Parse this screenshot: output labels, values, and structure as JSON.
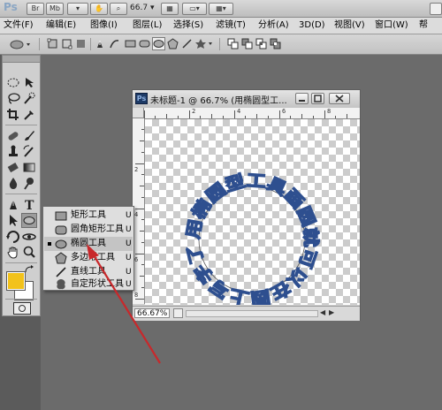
{
  "app": {
    "logo": "Ps",
    "top_buttons": [
      "Br",
      "Mb"
    ],
    "zoom_value": "66.7"
  },
  "menu": {
    "items": [
      "文件(F)",
      "编辑(E)",
      "图像(I)",
      "图层(L)",
      "选择(S)",
      "滤镜(T)",
      "分析(A)",
      "3D(D)",
      "视图(V)",
      "窗口(W)",
      "帮"
    ]
  },
  "options_bar": {
    "tool_icon": "ellipse-shape-icon",
    "shape_modes": [
      "shape-layers-icon",
      "paths-icon",
      "fill-pixels-icon"
    ],
    "shape_tools": [
      "pen-icon",
      "freeform-pen-icon",
      "rectangle-icon",
      "rounded-rectangle-icon",
      "ellipse-icon",
      "polygon-icon",
      "line-icon",
      "custom-shape-icon"
    ],
    "selected_shape": "ellipse-icon",
    "path_ops": [
      "add-path-icon",
      "subtract-path-icon",
      "intersect-path-icon",
      "exclude-path-icon"
    ]
  },
  "document": {
    "ps_badge": "Ps",
    "title": "未标题-1 @ 66.7% (用椭圆型工...",
    "zoom_status": "66.67%",
    "ruler_h": [
      "2",
      "4",
      "6",
      "8"
    ],
    "ruler_v": [
      "2",
      "4",
      "6",
      "8"
    ],
    "circle_text": "用椭圆型工具画圆就可以在圆上写字了",
    "text_color": "#2e4f8f"
  },
  "shape_flyout": {
    "items": [
      {
        "icon": "rectangle-icon",
        "label": "矩形工具",
        "key": "U",
        "active": false
      },
      {
        "icon": "rounded-rectangle-icon",
        "label": "圆角矩形工具",
        "key": "U",
        "active": false
      },
      {
        "icon": "ellipse-icon",
        "label": "椭圆工具",
        "key": "U",
        "active": true
      },
      {
        "icon": "polygon-icon",
        "label": "多边形工具",
        "key": "U",
        "active": false
      },
      {
        "icon": "line-icon",
        "label": "直线工具",
        "key": "U",
        "active": false
      },
      {
        "icon": "custom-shape-icon",
        "label": "自定形状工具",
        "key": "U",
        "active": false
      }
    ]
  },
  "colors": {
    "foreground": "#f2c21b",
    "background": "#ffffff",
    "annotation_arrow": "#c8282b"
  }
}
